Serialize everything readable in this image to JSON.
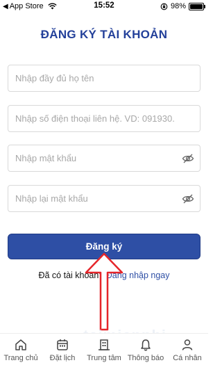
{
  "status_bar": {
    "back_label": "App Store",
    "time": "15:52",
    "battery_percent": "98%",
    "battery_level": 0.98
  },
  "form": {
    "title": "ĐĂNG KÝ TÀI KHOẢN",
    "full_name_placeholder": "Nhập đầy đủ họ tên",
    "phone_placeholder": "Nhập số điện thoại liên hệ. VD: 091930...",
    "password_placeholder": "Nhập mật khẩu",
    "confirm_password_placeholder": "Nhập lại mật khẩu",
    "submit_label": "Đăng ký",
    "login_prompt": "Đã có tài khoản?",
    "login_link": "Đăng nhập ngay"
  },
  "tabbar": {
    "items": [
      {
        "label": "Trang chủ",
        "icon": "home-icon"
      },
      {
        "label": "Đặt lịch",
        "icon": "calendar-icon"
      },
      {
        "label": "Trung tâm",
        "icon": "building-icon"
      },
      {
        "label": "Thông báo",
        "icon": "bell-icon"
      },
      {
        "label": "Cá nhân",
        "icon": "person-icon"
      }
    ]
  },
  "colors": {
    "accent": "#2e4fa5",
    "title": "#23409a",
    "annotation_arrow": "#e5252a"
  }
}
